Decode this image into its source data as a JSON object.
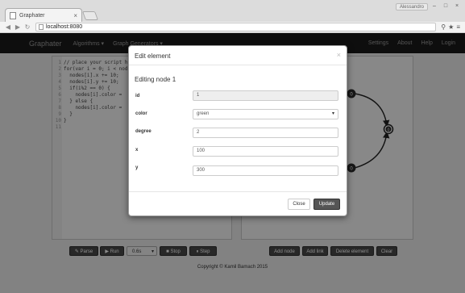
{
  "browser": {
    "tab_title": "Graphater",
    "tab_close": "×",
    "url": "localhost:8080",
    "user": "Alessandro",
    "window_buttons": [
      "–",
      "□",
      "×"
    ],
    "nav_icons": [
      "◀",
      "▶",
      "↻"
    ],
    "toolbar_icons": [
      "⚲",
      "★",
      "≡"
    ]
  },
  "navbar": {
    "brand": "Graphater",
    "menus": [
      "Algorithms ▾",
      "Graph Generators ▾"
    ],
    "right_links": [
      "Settings",
      "About",
      "Help",
      "Login"
    ]
  },
  "editor": {
    "lines": [
      {
        "n": "1",
        "text": "// place your script h"
      },
      {
        "n": "2",
        "text": "for(var i = 0; i < nod"
      },
      {
        "n": "3",
        "text": "  nodes[i].x += 10;"
      },
      {
        "n": "4",
        "text": "  nodes[i].y += 10;"
      },
      {
        "n": "5",
        "text": "  if(i%2 == 0) {"
      },
      {
        "n": "6",
        "text": "    nodes[i].color ="
      },
      {
        "n": "7",
        "text": "  } else {"
      },
      {
        "n": "8",
        "text": "    nodes[i].color ="
      },
      {
        "n": "9",
        "text": "  }"
      },
      {
        "n": "10",
        "text": "}"
      },
      {
        "n": "11",
        "text": ""
      }
    ]
  },
  "graph": {
    "nodes": [
      {
        "label": "0",
        "color": "#2a2a2a"
      },
      {
        "label": "0",
        "color": "#2a2a2a"
      },
      {
        "label": "0",
        "color": "#2a2a2a"
      }
    ]
  },
  "controls": {
    "parse": "✎ Parse",
    "run": "▶ Run",
    "speed": "0.6s",
    "stop": "■ Stop",
    "step": "⏸ Step",
    "add_node": "Add node",
    "add_link": "Add link",
    "delete_element": "Delete element",
    "clear": "Clear"
  },
  "footer": "Copyright © Kamil Bamach 2015",
  "modal": {
    "title": "Edit element",
    "close": "×",
    "subtitle": "Editing node 1",
    "fields": {
      "id": {
        "label": "id",
        "value": "1"
      },
      "color": {
        "label": "color",
        "value": "green"
      },
      "degree": {
        "label": "degree",
        "value": "2"
      },
      "x": {
        "label": "x",
        "value": "100"
      },
      "y": {
        "label": "y",
        "value": "300"
      }
    },
    "close_button": "Close",
    "update_button": "Update"
  }
}
